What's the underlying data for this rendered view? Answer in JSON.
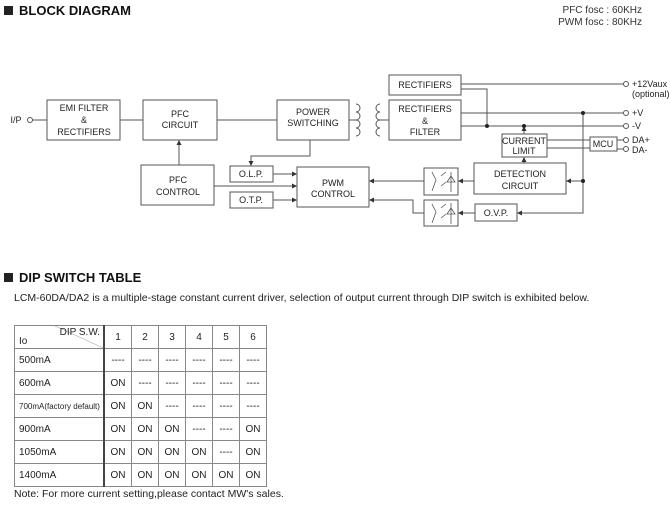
{
  "sections": {
    "block_diagram": "BLOCK DIAGRAM",
    "dip_table": "DIP SWITCH TABLE"
  },
  "fosc": {
    "pfc": "PFC fosc : 60KHz",
    "pwm": "PWM fosc : 80KHz"
  },
  "diagram": {
    "input": "I/P",
    "emi": [
      "EMI FILTER",
      "&",
      "RECTIFIERS"
    ],
    "pfc_circuit": [
      "PFC",
      "CIRCUIT"
    ],
    "power_switching": [
      "POWER",
      "SWITCHING"
    ],
    "pfc_control": [
      "PFC",
      "CONTROL"
    ],
    "olp": "O.L.P.",
    "otp": "O.T.P.",
    "pwm_control": [
      "PWM",
      "CONTROL"
    ],
    "rectifiers": "RECTIFIERS",
    "rect_filter": [
      "RECTIFIERS",
      "&",
      "FILTER"
    ],
    "current_limit": [
      "CURRENT",
      "LIMIT"
    ],
    "mcu": "MCU",
    "detection": [
      "DETECTION",
      "CIRCUIT"
    ],
    "ovp": "O.V.P.",
    "outputs": {
      "aux": "+12Vaux",
      "aux_note": "(optional)",
      "pv": "+V",
      "nv": "-V",
      "dap": "DA+",
      "dan": "DA-"
    }
  },
  "description": "LCM-60DA/DA2 is a multiple-stage constant current driver, selection of output current through DIP switch is exhibited below.",
  "table": {
    "corner_top": "DIP S.W.",
    "corner_bottom": "Io",
    "columns": [
      "1",
      "2",
      "3",
      "4",
      "5",
      "6"
    ],
    "rows": [
      {
        "label": "500mA",
        "cells": [
          "----",
          "----",
          "----",
          "----",
          "----",
          "----"
        ]
      },
      {
        "label": "600mA",
        "cells": [
          "ON",
          "----",
          "----",
          "----",
          "----",
          "----"
        ]
      },
      {
        "label": "700mA(factory default)",
        "cells": [
          "ON",
          "ON",
          "----",
          "----",
          "----",
          "----"
        ]
      },
      {
        "label": "900mA",
        "cells": [
          "ON",
          "ON",
          "ON",
          "----",
          "----",
          "ON"
        ]
      },
      {
        "label": "1050mA",
        "cells": [
          "ON",
          "ON",
          "ON",
          "ON",
          "----",
          "ON"
        ]
      },
      {
        "label": "1400mA",
        "cells": [
          "ON",
          "ON",
          "ON",
          "ON",
          "ON",
          "ON"
        ]
      }
    ]
  },
  "note": "Note: For more current setting,please contact MW's sales."
}
